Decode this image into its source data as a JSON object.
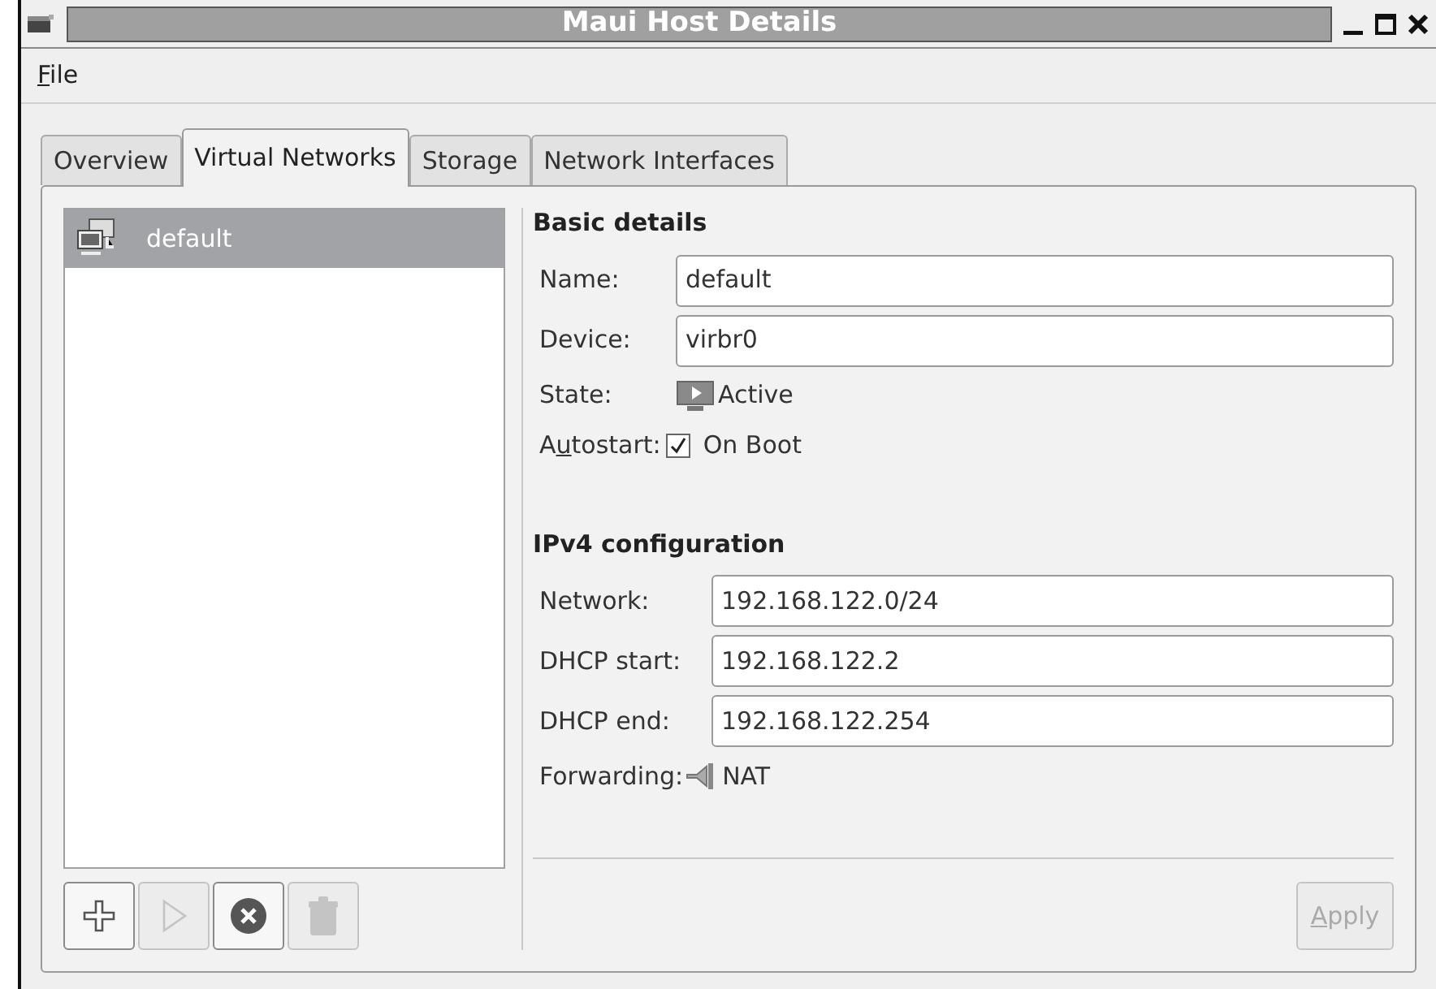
{
  "window": {
    "title": "Maui Host Details"
  },
  "menu": [
    {
      "label": [
        {
          "text": "F",
          "underlined": true
        },
        {
          "text": "ile",
          "underlined": false
        }
      ]
    }
  ],
  "tabs": [
    {
      "label": "Overview",
      "selected": false
    },
    {
      "label": "Virtual Networks",
      "selected": true
    },
    {
      "label": "Storage",
      "selected": false
    },
    {
      "label": "Network Interfaces",
      "selected": false
    }
  ],
  "networks": [
    {
      "name": "default",
      "selected": true
    }
  ],
  "list_buttons": [
    {
      "kind": "add",
      "disabled": false
    },
    {
      "kind": "start",
      "disabled": true
    },
    {
      "kind": "stop",
      "disabled": false
    },
    {
      "kind": "delete",
      "disabled": true
    }
  ],
  "basic_details": {
    "title": "Basic details",
    "name_label": "Name:",
    "name": "default",
    "device_label": "Device:",
    "device": "virbr0",
    "state_label": "State:",
    "state": "Active",
    "autostart_label": [
      {
        "text": "A",
        "underlined": false
      },
      {
        "text": "u",
        "underlined": true
      },
      {
        "text": "tostart:",
        "underlined": false
      }
    ],
    "autostart": "On Boot",
    "autostart_checked": true
  },
  "ipv4": {
    "title": "IPv4 configuration",
    "fields": [
      {
        "label": "Network:",
        "value": "192.168.122.0/24"
      },
      {
        "label": "DHCP start:",
        "value": "192.168.122.2"
      },
      {
        "label": "DHCP end:",
        "value": "192.168.122.254"
      }
    ],
    "forwarding_label": "Forwarding:",
    "forwarding": "NAT"
  },
  "apply": {
    "label": [
      {
        "text": "A",
        "underlined": true
      },
      {
        "text": "pply",
        "underlined": false
      }
    ],
    "disabled": true
  }
}
